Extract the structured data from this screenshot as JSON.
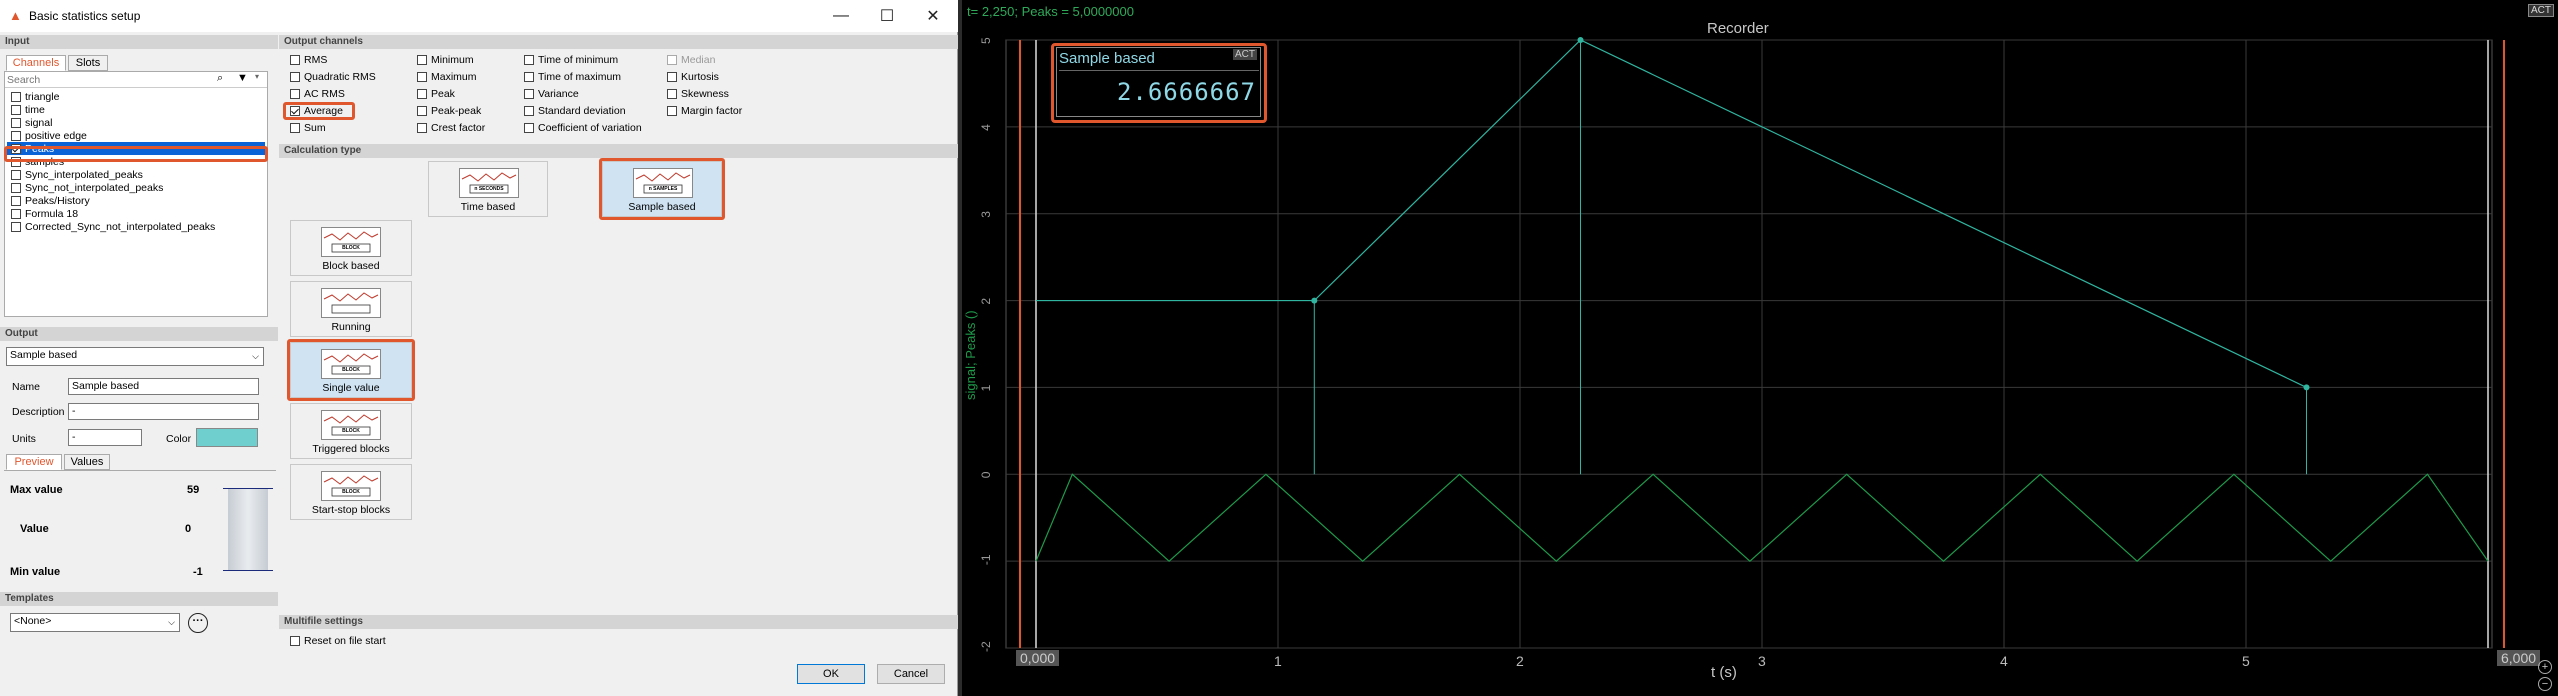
{
  "dialog": {
    "title": "Basic statistics setup",
    "input": {
      "section_label": "Input",
      "tabs": [
        {
          "label": "Channels"
        },
        {
          "label": "Slots"
        }
      ],
      "search_placeholder": "Search",
      "channels": [
        {
          "name": "triangle",
          "checked": false
        },
        {
          "name": "time",
          "checked": false
        },
        {
          "name": "signal",
          "checked": false
        },
        {
          "name": "positive edge",
          "checked": false
        },
        {
          "name": "Peaks",
          "checked": true,
          "selected": true
        },
        {
          "name": "samples",
          "checked": false
        },
        {
          "name": "Sync_interpolated_peaks",
          "checked": false
        },
        {
          "name": "Sync_not_interpolated_peaks",
          "checked": false
        },
        {
          "name": "Peaks/History",
          "checked": false
        },
        {
          "name": "Formula 18",
          "checked": false
        },
        {
          "name": "Corrected_Sync_not_interpolated_peaks",
          "checked": false
        }
      ]
    },
    "output_channels": {
      "section_label": "Output channels",
      "columns": [
        [
          {
            "label": "RMS",
            "checked": false
          },
          {
            "label": "Quadratic RMS",
            "checked": false
          },
          {
            "label": "AC RMS",
            "checked": false
          },
          {
            "label": "Average",
            "checked": true
          },
          {
            "label": "Sum",
            "checked": false
          }
        ],
        [
          {
            "label": "Minimum",
            "checked": false
          },
          {
            "label": "Maximum",
            "checked": false
          },
          {
            "label": "Peak",
            "checked": false
          },
          {
            "label": "Peak-peak",
            "checked": false
          },
          {
            "label": "Crest factor",
            "checked": false
          }
        ],
        [
          {
            "label": "Time of minimum",
            "checked": false
          },
          {
            "label": "Time of maximum",
            "checked": false
          },
          {
            "label": "Variance",
            "checked": false
          },
          {
            "label": "Standard deviation",
            "checked": false
          },
          {
            "label": "Coefficient of variation",
            "checked": false
          }
        ],
        [
          {
            "label": "Median",
            "checked": false,
            "disabled": true
          },
          {
            "label": "Kurtosis",
            "checked": false
          },
          {
            "label": "Skewness",
            "checked": false
          },
          {
            "label": "Margin factor",
            "checked": false
          }
        ]
      ]
    },
    "calculation_type": {
      "section_label": "Calculation type",
      "options": [
        {
          "label": "Time based",
          "selected": false,
          "pic_text": "n SECONDS"
        },
        {
          "label": "Sample based",
          "selected": true,
          "pic_text": "n SAMPLES"
        },
        {
          "label": "Block based",
          "selected": false,
          "pic_text": "BLOCK"
        },
        {
          "label": "Running",
          "selected": false,
          "pic_text": ""
        },
        {
          "label": "Single value",
          "selected": true,
          "pic_text": "BLOCK"
        },
        {
          "label": "Triggered blocks",
          "selected": false,
          "pic_text": "BLOCK"
        },
        {
          "label": "Start-stop blocks",
          "selected": false,
          "pic_text": "BLOCK"
        }
      ]
    },
    "output": {
      "section_label": "Output",
      "type_value": "Sample based",
      "name_label": "Name",
      "name_value": "Sample based",
      "description_label": "Description",
      "description_value": "-",
      "units_label": "Units",
      "units_value": "-",
      "color_label": "Color",
      "color_value": "#6fcfcf",
      "tabs": [
        {
          "label": "Preview"
        },
        {
          "label": "Values"
        }
      ],
      "max_label": "Max value",
      "max_value": "59",
      "value_label": "Value",
      "value_value": "0",
      "min_label": "Min value",
      "min_value": "-1"
    },
    "templates": {
      "section_label": "Templates",
      "value": "<None>"
    },
    "multifile": {
      "section_label": "Multifile settings",
      "reset_label": "Reset on file start",
      "reset_checked": false
    },
    "buttons": {
      "ok": "OK",
      "cancel": "Cancel"
    }
  },
  "recorder": {
    "cursor_readout": "t= 2,250; Peaks = 5,0000000",
    "title": "Recorder",
    "act_label": "ACT",
    "ylabel": "signal; Peaks ()",
    "xlabel": "t (s)",
    "x_start_label": "0,000",
    "x_end_label": "6,000",
    "x_ticks": [
      "1",
      "2",
      "3",
      "4",
      "5"
    ],
    "y_ticks": [
      "5",
      "4",
      "3",
      "2",
      "1",
      "0",
      "-1",
      "-2"
    ],
    "value_box": {
      "label": "Sample based",
      "act": "ACT",
      "value": "2.6666667"
    },
    "colors": {
      "signal": "#1e9a4a",
      "peaks": "#2fb5a0",
      "cursor_readout": "#2faa5a",
      "accent": "#e0572e"
    }
  },
  "chart_data": {
    "type": "line",
    "xlabel": "t (s)",
    "ylabel": "signal; Peaks ()",
    "xlim": [
      0,
      6
    ],
    "ylim": [
      -2,
      5
    ],
    "grid": true,
    "series": [
      {
        "name": "signal",
        "x": [
          0,
          0.15,
          0.55,
          0.95,
          1.35,
          1.75,
          2.15,
          2.55,
          2.95,
          3.35,
          3.75,
          4.15,
          4.55,
          4.95,
          5.35,
          5.75,
          6.0
        ],
        "y": [
          -1,
          0,
          -1,
          0,
          -1,
          0,
          -1,
          0,
          -1,
          0,
          -1,
          0,
          -1,
          0,
          -1,
          0,
          -1
        ]
      },
      {
        "name": "Peaks",
        "x": [
          0.0,
          1.15,
          2.25,
          5.25
        ],
        "y": [
          2,
          2,
          5,
          1
        ]
      }
    ]
  }
}
